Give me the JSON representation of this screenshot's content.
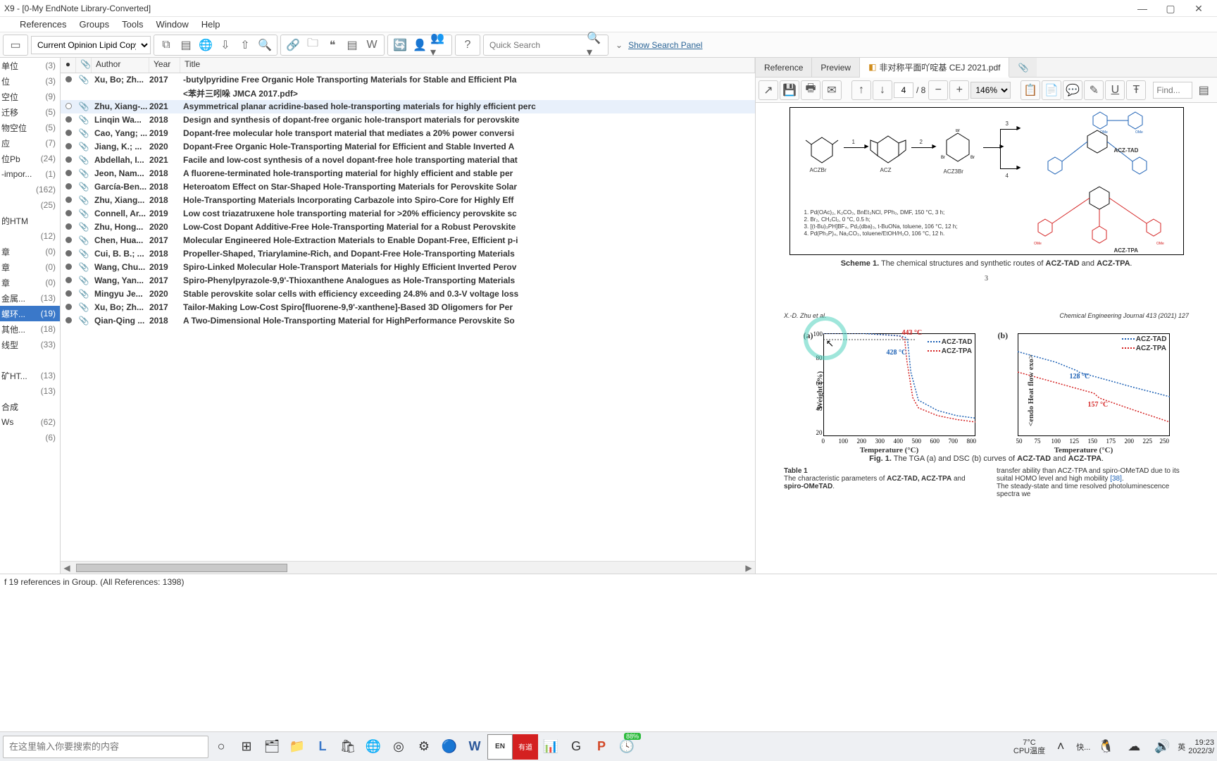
{
  "window": {
    "title": "X9 - [0-My EndNote Library-Converted]",
    "min": "—",
    "max": "▢",
    "close": "✕"
  },
  "menubar": [
    "",
    "References",
    "Groups",
    "Tools",
    "Window",
    "Help"
  ],
  "toolbar": {
    "style": "Current Opinion Lipid Copy",
    "quick_search_ph": "Quick Search",
    "show_panel": "Show Search Panel"
  },
  "groups": [
    {
      "name": "单位",
      "count": "(3)"
    },
    {
      "name": "位",
      "count": "(3)"
    },
    {
      "name": "空位",
      "count": "(9)"
    },
    {
      "name": "迁移",
      "count": "(5)"
    },
    {
      "name": "物空位",
      "count": "(5)"
    },
    {
      "name": "应",
      "count": "(7)"
    },
    {
      "name": "位Pb",
      "count": "(24)"
    },
    {
      "name": "-impor...",
      "count": "(1)"
    },
    {
      "name": "",
      "count": "(162)"
    },
    {
      "name": "",
      "count": "(25)"
    },
    {
      "name": "的HTM",
      "count": ""
    },
    {
      "name": "",
      "count": "(12)"
    },
    {
      "name": "章",
      "count": "(0)"
    },
    {
      "name": "章",
      "count": "(0)"
    },
    {
      "name": "章",
      "count": "(0)"
    },
    {
      "name": "金属...",
      "count": "(13)"
    },
    {
      "name": "螺环...",
      "count": "(19)",
      "sel": true
    },
    {
      "name": "其他...",
      "count": "(18)"
    },
    {
      "name": "线型",
      "count": "(33)"
    },
    {
      "name": "",
      "count": ""
    },
    {
      "name": "矿HT...",
      "count": "(13)"
    },
    {
      "name": "",
      "count": "(13)"
    },
    {
      "name": "合成",
      "count": ""
    },
    {
      "name": "Ws",
      "count": "(62)"
    },
    {
      "name": "",
      "count": "(6)"
    }
  ],
  "list_headers": {
    "read": "●",
    "clip": "📎",
    "author": "Author",
    "year": "Year",
    "title": "Title"
  },
  "refs": [
    {
      "author": "Xu, Bo; Zh...",
      "year": "2017",
      "title": "-butylpyridine Free Organic Hole Transporting Materials for Stable and Efficient Pla",
      "extratitle": "<苯并三吲哚 JMCA 2017.pdf>"
    },
    {
      "author": "Zhu, Xiang-...",
      "year": "2021",
      "title": "Asymmetrical planar acridine-based hole-transporting materials for highly efficient perc",
      "sel": true,
      "open": true
    },
    {
      "author": "Linqin Wa...",
      "year": "2018",
      "title": "Design and synthesis of dopant-free organic hole-transport materials for perovskite"
    },
    {
      "author": "Cao, Yang; ...",
      "year": "2019",
      "title": "Dopant-free molecular hole transport material that mediates a 20% power conversi"
    },
    {
      "author": "Jiang, K.; ...",
      "year": "2020",
      "title": "Dopant-Free Organic Hole-Transporting Material for Efficient and Stable Inverted A"
    },
    {
      "author": "Abdellah, I...",
      "year": "2021",
      "title": "Facile and low-cost synthesis of a novel dopant-free hole transporting material that"
    },
    {
      "author": "Jeon, Nam...",
      "year": "2018",
      "title": "A fluorene-terminated hole-transporting material for highly efficient and stable per"
    },
    {
      "author": "García-Ben...",
      "year": "2018",
      "title": "Heteroatom Effect on Star-Shaped Hole-Transporting Materials for Perovskite Solar"
    },
    {
      "author": "Zhu, Xiang...",
      "year": "2018",
      "title": "Hole-Transporting Materials Incorporating Carbazole into Spiro-Core for Highly Eff"
    },
    {
      "author": "Connell, Ar...",
      "year": "2019",
      "title": "Low cost triazatruxene hole transporting material for >20% efficiency perovskite sc"
    },
    {
      "author": "Zhu, Hong...",
      "year": "2020",
      "title": "Low-Cost Dopant Additive-Free Hole-Transporting Material for a Robust Perovskite"
    },
    {
      "author": "Chen, Hua...",
      "year": "2017",
      "title": "Molecular Engineered Hole-Extraction Materials to Enable Dopant-Free, Efficient p-i"
    },
    {
      "author": "Cui, B. B.; ...",
      "year": "2018",
      "title": "Propeller-Shaped, Triarylamine-Rich, and Dopant-Free Hole-Transporting Materials"
    },
    {
      "author": "Wang, Chu...",
      "year": "2019",
      "title": "Spiro-Linked Molecular Hole-Transport Materials for Highly Efficient Inverted Perov"
    },
    {
      "author": "Wang, Yan...",
      "year": "2017",
      "title": "Spiro-Phenylpyrazole-9,9'-Thioxanthene Analogues as Hole-Transporting Materials"
    },
    {
      "author": "Mingyu Je...",
      "year": "2020",
      "title": "Stable perovskite solar cells with efficiency exceeding 24.8% and 0.3-V voltage loss"
    },
    {
      "author": "Xu, Bo; Zh...",
      "year": "2017",
      "title": "Tailor-Making Low-Cost Spiro[fluorene-9,9'-xanthene]-Based 3D Oligomers for Per"
    },
    {
      "author": "Qian-Qing ...",
      "year": "2018",
      "title": "A Two-Dimensional Hole-Transporting Material for HighPerformance Perovskite So"
    }
  ],
  "statusbar": "f 19 references in Group. (All References: 1398)",
  "right": {
    "tabs": {
      "ref": "Reference",
      "prev": "Preview",
      "doc": "非对称平面吖啶基 CEJ 2021.pdf"
    },
    "pdf_toolbar": {
      "page": "4",
      "pages": "/ 8",
      "zoom": "146%",
      "find": "Find..."
    },
    "running": {
      "left": "X.-D. Zhu et al.",
      "right": "Chemical Engineering Journal 413 (2021) 127"
    },
    "scheme_cap_pre": "Scheme 1.",
    "scheme_cap_txt": " The chemical structures and synthetic routes of ",
    "scheme_b1": "ACZ-TAD",
    "scheme_and": " and ",
    "scheme_b2": "ACZ-TPA",
    "page_num": "3",
    "fig_cap_pre": "Fig. 1.",
    "fig_cap_txt": " The TGA (a) and DSC (b) curves of ",
    "scheme_labels": {
      "a": "ACZBr",
      "b": "ACZ",
      "c": "ACZ3Br",
      "d": "ACZ-TAD",
      "e": "ACZ-TPA"
    },
    "reagents": "1. Pd(OAc)₂, K₂CO₃, BnEt₃NCl, PPh₃, DMF, 150 °C, 3 h;\n2. Br₂, CH₂Cl₂, 0 °C, 0.5 h;\n3. [(t-Bu)₃PH]BF₄, Pd₂(dba)₃, t-BuONa, toluene, 106 °C, 12 h;\n4. Pd(Ph₃P)₄, Na₂CO₃, toluene/EtOH/H₂O, 106 °C, 12 h.",
    "table_head": "Table 1",
    "table_sub_pre": "The characteristic parameters of ",
    "table_sub_b": "ACZ-TAD, ACZ-TPA",
    "table_sub_mid": " and ",
    "table_sub_b2": "spiro-OMeTAD",
    "para_right": "transfer ability than ACZ-TPA and spiro-OMeTAD due to its suital HOMO level and high mobility ",
    "ref38": "[38]",
    "para_right2": ".\n   The steady-state and time resolved photoluminescence spectra we"
  },
  "chart_data": [
    {
      "type": "line",
      "title": "(a) TGA",
      "xlabel": "Temperature (°C)",
      "ylabel": "Weight (%)",
      "xlim": [
        0,
        800
      ],
      "ylim": [
        20,
        100
      ],
      "x_ticks": [
        0,
        100,
        200,
        300,
        400,
        500,
        600,
        700,
        800
      ],
      "y_ticks": [
        20,
        40,
        60,
        80,
        100
      ],
      "series": [
        {
          "name": "ACZ-TAD",
          "color": "#1a5fb4",
          "x": [
            0,
            100,
            200,
            300,
            400,
            430,
            443,
            460,
            500,
            600,
            700,
            800
          ],
          "y": [
            100,
            100,
            100,
            99,
            98,
            97,
            95,
            70,
            48,
            40,
            36,
            34
          ]
        },
        {
          "name": "ACZ-TPA",
          "color": "#d42020",
          "x": [
            0,
            100,
            200,
            300,
            400,
            428,
            440,
            470,
            500,
            600,
            700,
            800
          ],
          "y": [
            100,
            100,
            100,
            99,
            98,
            95,
            78,
            50,
            42,
            36,
            33,
            31
          ]
        }
      ],
      "annotations": [
        {
          "text": "443 °C",
          "x": 440,
          "y": 98,
          "color": "#d42020"
        },
        {
          "text": "428 °C",
          "x": 420,
          "y": 90,
          "color": "#1a5fb4"
        }
      ]
    },
    {
      "type": "line",
      "title": "(b) DSC",
      "xlabel": "Temperature (°C)",
      "ylabel": "<endo Heat flow exo>",
      "xlim": [
        50,
        250
      ],
      "ylim": [
        0,
        1
      ],
      "x_ticks": [
        50,
        75,
        100,
        125,
        150,
        175,
        200,
        225,
        250
      ],
      "series": [
        {
          "name": "ACZ-TAD",
          "color": "#1a5fb4",
          "x": [
            50,
            100,
            128,
            130,
            150,
            200,
            250
          ],
          "y": [
            0.82,
            0.72,
            0.64,
            0.62,
            0.58,
            0.48,
            0.38
          ]
        },
        {
          "name": "ACZ-TPA",
          "color": "#d42020",
          "x": [
            50,
            100,
            150,
            157,
            160,
            200,
            250
          ],
          "y": [
            0.62,
            0.52,
            0.42,
            0.38,
            0.36,
            0.26,
            0.14
          ]
        }
      ],
      "annotations": [
        {
          "text": "128 °C",
          "x": 128,
          "y": 0.64,
          "color": "#1a5fb4"
        },
        {
          "text": "157 °C",
          "x": 157,
          "y": 0.35,
          "color": "#d42020"
        }
      ]
    }
  ],
  "taskbar": {
    "search_ph": "在这里输入你要搜索的内容",
    "temp": {
      "v": "7°C",
      "l": "CPU温度"
    },
    "battery": "88%",
    "lang1": "快...",
    "ime": "英",
    "time": "19:23",
    "date": "2022/3/"
  }
}
